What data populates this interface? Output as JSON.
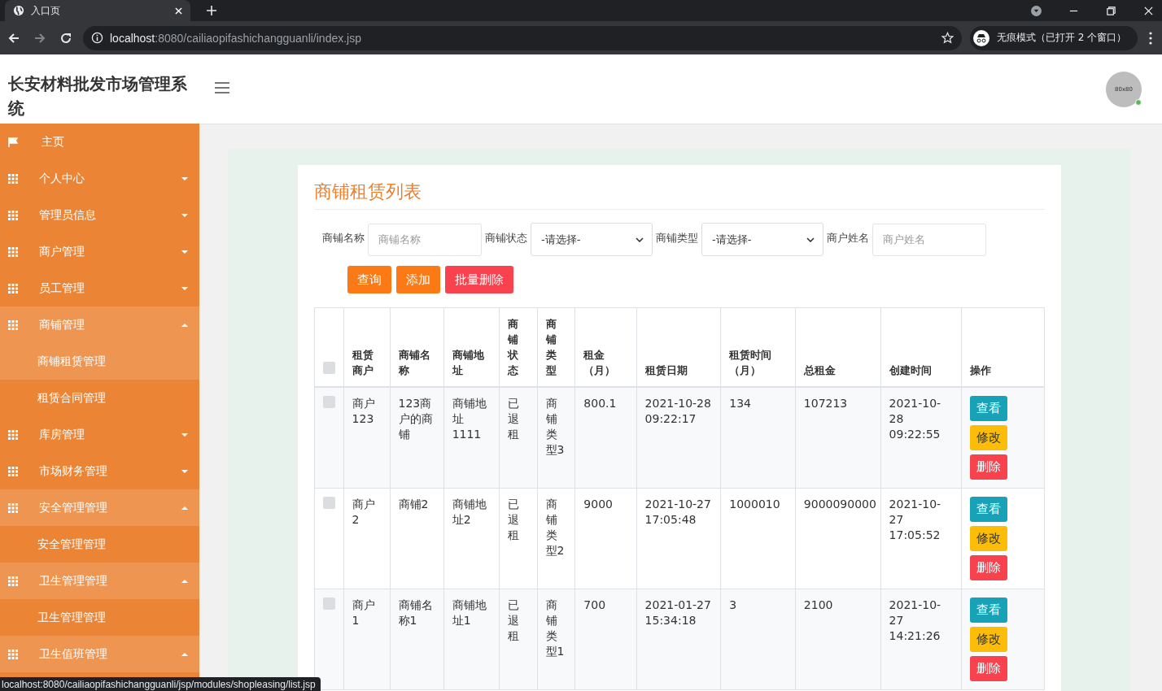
{
  "browser": {
    "tab_title": "入口页",
    "url_host": "localhost",
    "url_path": ":8080/cailiaopifashichangguanli/index.jsp",
    "profile": "无痕模式（已打开 2 个窗口）",
    "status_url": "localhost:8080/cailiaopifashichangguanli/jsp/modules/shopleasing/list.jsp"
  },
  "header": {
    "title": "长安材料批发市场管理系统",
    "avatar": "80x80"
  },
  "sidebar": {
    "items": [
      {
        "label": "主页",
        "kind": "link"
      },
      {
        "label": "个人中心",
        "kind": "menu",
        "expanded": false
      },
      {
        "label": "管理员信息",
        "kind": "menu",
        "expanded": false
      },
      {
        "label": "商户管理",
        "kind": "menu",
        "expanded": false
      },
      {
        "label": "员工管理",
        "kind": "menu",
        "expanded": false
      },
      {
        "label": "商铺管理",
        "kind": "menu",
        "expanded": true,
        "children": [
          {
            "label": "商铺租赁管理",
            "selected": true
          },
          {
            "label": "租赁合同管理",
            "selected": false
          }
        ]
      },
      {
        "label": "库房管理",
        "kind": "menu",
        "expanded": false
      },
      {
        "label": "市场财务管理",
        "kind": "menu",
        "expanded": false
      },
      {
        "label": "安全管理管理",
        "kind": "menu",
        "expanded": true,
        "children": [
          {
            "label": "安全管理管理",
            "selected": false
          }
        ]
      },
      {
        "label": "卫生管理管理",
        "kind": "menu",
        "expanded": true,
        "children": [
          {
            "label": "卫生管理管理",
            "selected": false
          }
        ]
      },
      {
        "label": "卫生值班管理",
        "kind": "menu",
        "expanded": true
      }
    ]
  },
  "page": {
    "title": "商铺租赁列表",
    "filters": [
      {
        "label": "商铺名称",
        "kind": "input",
        "placeholder": "商铺名称"
      },
      {
        "label": "商铺状态",
        "kind": "select",
        "value": "-请选择-"
      },
      {
        "label": "商铺类型",
        "kind": "select",
        "value": "-请选择-"
      },
      {
        "label": "商户姓名",
        "kind": "input",
        "placeholder": "商户姓名"
      }
    ],
    "buttons": [
      {
        "label": "查询",
        "kind": "primary"
      },
      {
        "label": "添加",
        "kind": "primary"
      },
      {
        "label": "批量删除",
        "kind": "danger"
      }
    ],
    "table": {
      "select_all_checked": false,
      "columns": [
        "租赁商户",
        "商铺名称",
        "商铺地址",
        "商铺状态",
        "商铺类型",
        "租金（月）",
        "租赁日期",
        "租赁时间（月）",
        "总租金",
        "创建时间",
        "操作"
      ],
      "rows": [
        {
          "checked": false,
          "cells": [
            "商户123",
            "123商户的商铺",
            "商铺地址1111",
            "已退租",
            "商铺类型3",
            "800.1",
            "2021-10-28 09:22:17",
            "134",
            "107213",
            "2021-10-28 09:22:55"
          ],
          "actions": [
            {
              "label": "查看",
              "kind": "view"
            },
            {
              "label": "修改",
              "kind": "edit"
            },
            {
              "label": "删除",
              "kind": "delete"
            }
          ]
        },
        {
          "checked": false,
          "cells": [
            "商户2",
            "商铺2",
            "商铺地址2",
            "已退租",
            "商铺类型2",
            "9000",
            "2021-10-27 17:05:48",
            "1000010",
            "9000090000",
            "2021-10-27 17:05:52"
          ],
          "actions": [
            {
              "label": "查看",
              "kind": "view"
            },
            {
              "label": "修改",
              "kind": "edit"
            },
            {
              "label": "删除",
              "kind": "delete"
            }
          ]
        },
        {
          "checked": false,
          "cells": [
            "商户1",
            "商铺名称1",
            "商铺地址1",
            "已退租",
            "商铺类型1",
            "700",
            "2021-01-27 15:34:18",
            "3",
            "2100",
            "2021-10-27 14:21:26"
          ],
          "actions": [
            {
              "label": "查看",
              "kind": "view"
            },
            {
              "label": "修改",
              "kind": "edit"
            },
            {
              "label": "删除",
              "kind": "delete"
            }
          ]
        }
      ]
    }
  }
}
